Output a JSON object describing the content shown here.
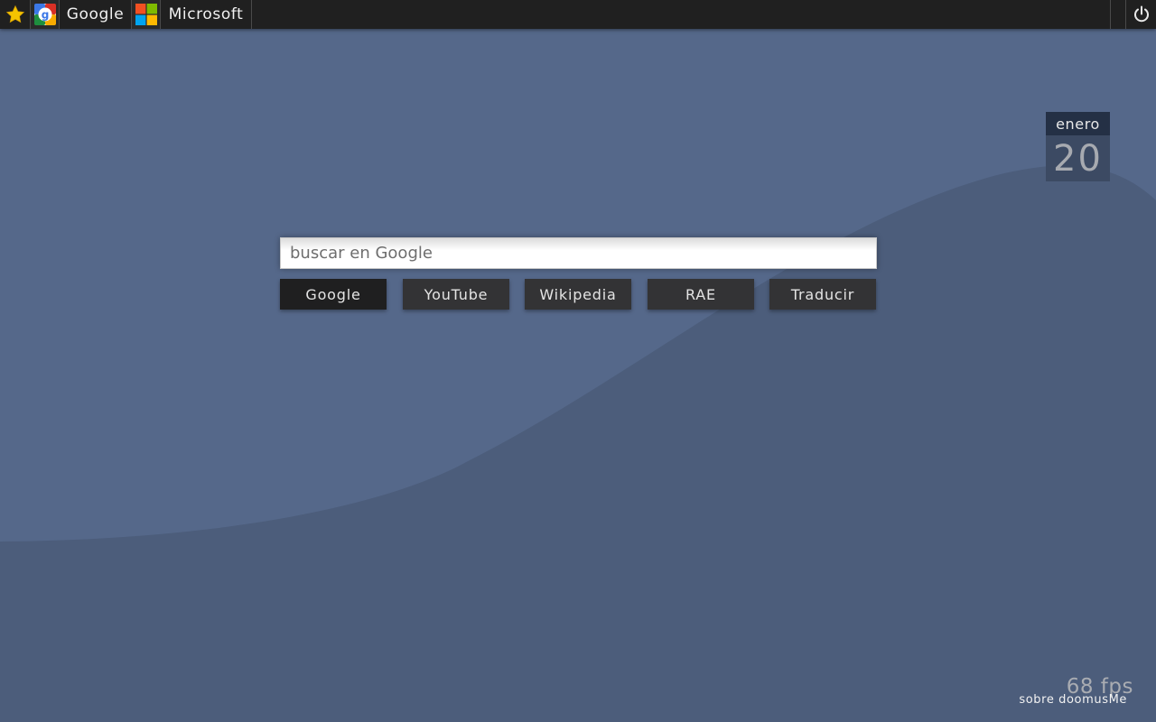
{
  "topbar": {
    "bookmarks": [
      {
        "label": "Google",
        "icon": "google-logo-icon"
      },
      {
        "label": "Microsoft",
        "icon": "microsoft-logo-icon"
      }
    ],
    "star_icon": "star-icon",
    "power_icon": "power-icon"
  },
  "calendar": {
    "month": "enero",
    "day": "20"
  },
  "search": {
    "placeholder": "buscar en Google",
    "value": ""
  },
  "engines": [
    {
      "label": "Google",
      "active": true
    },
    {
      "label": "YouTube",
      "active": false
    },
    {
      "label": "Wikipedia",
      "active": false
    },
    {
      "label": "RAE",
      "active": false
    },
    {
      "label": "Traducir",
      "active": false
    }
  ],
  "footer": {
    "fps": "68 fps",
    "about": "sobre doomusMe"
  },
  "colors": {
    "background": "#55688a",
    "background_wave": "#4c5d7b",
    "topbar": "#202020",
    "star": "#f5c400"
  }
}
